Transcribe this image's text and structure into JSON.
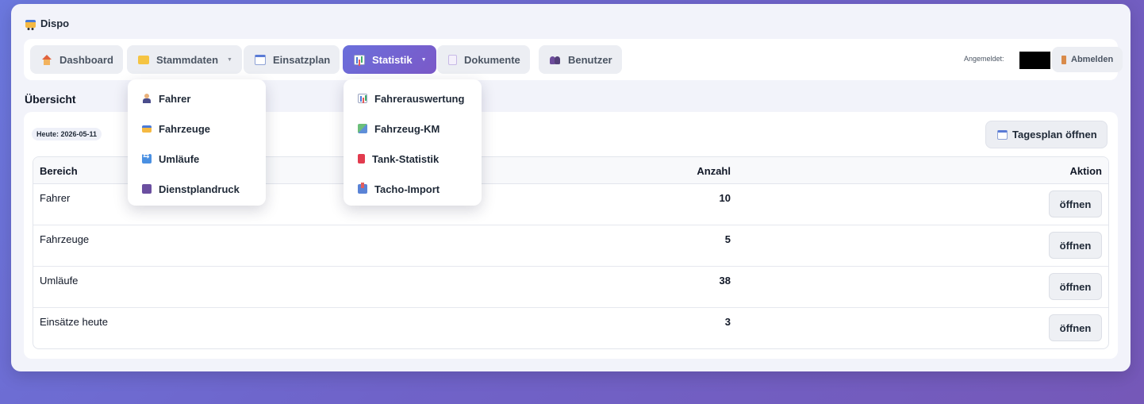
{
  "app": {
    "title": "Dispo"
  },
  "nav": {
    "items": [
      {
        "label": "Dashboard",
        "icon": "house-icon"
      },
      {
        "label": "Stammdaten",
        "icon": "folder-icon",
        "dropdown": true
      },
      {
        "label": "Einsatzplan",
        "icon": "calendar-icon"
      },
      {
        "label": "Statistik",
        "icon": "bar-chart-icon",
        "dropdown": true,
        "active": true
      },
      {
        "label": "Dokumente",
        "icon": "document-icon"
      },
      {
        "label": "Benutzer",
        "icon": "users-icon"
      }
    ],
    "login_label": "Angemeldet:",
    "logout_label": "Abmelden"
  },
  "menus": {
    "stammdaten": [
      {
        "label": "Fahrer",
        "icon": "person-icon"
      },
      {
        "label": "Fahrzeuge",
        "icon": "bus-icon"
      },
      {
        "label": "Umläufe",
        "icon": "repeat-icon"
      },
      {
        "label": "Dienstplandruck",
        "icon": "printer-icon"
      }
    ],
    "statistik": [
      {
        "label": "Fahrerauswertung",
        "icon": "bar-chart-icon"
      },
      {
        "label": "Fahrzeug-KM",
        "icon": "map-icon"
      },
      {
        "label": "Tank-Statistik",
        "icon": "fuel-pump-icon"
      },
      {
        "label": "Tacho-Import",
        "icon": "inbox-tray-icon"
      }
    ]
  },
  "overview": {
    "title": "Übersicht",
    "today": "Heute: 2026-05-11",
    "tagesplan_label": "Tagesplan öffnen",
    "columns": [
      "Bereich",
      "Anzahl",
      "Aktion"
    ],
    "rows": [
      {
        "bereich": "Fahrer",
        "anzahl": "10",
        "action": "öffnen"
      },
      {
        "bereich": "Fahrzeuge",
        "anzahl": "5",
        "action": "öffnen"
      },
      {
        "bereich": "Umläufe",
        "anzahl": "38",
        "action": "öffnen"
      },
      {
        "bereich": "Einsätze heute",
        "anzahl": "3",
        "action": "öffnen"
      }
    ]
  },
  "colors": {
    "accent": "#6f63d3",
    "background": "#f2f3fa"
  }
}
